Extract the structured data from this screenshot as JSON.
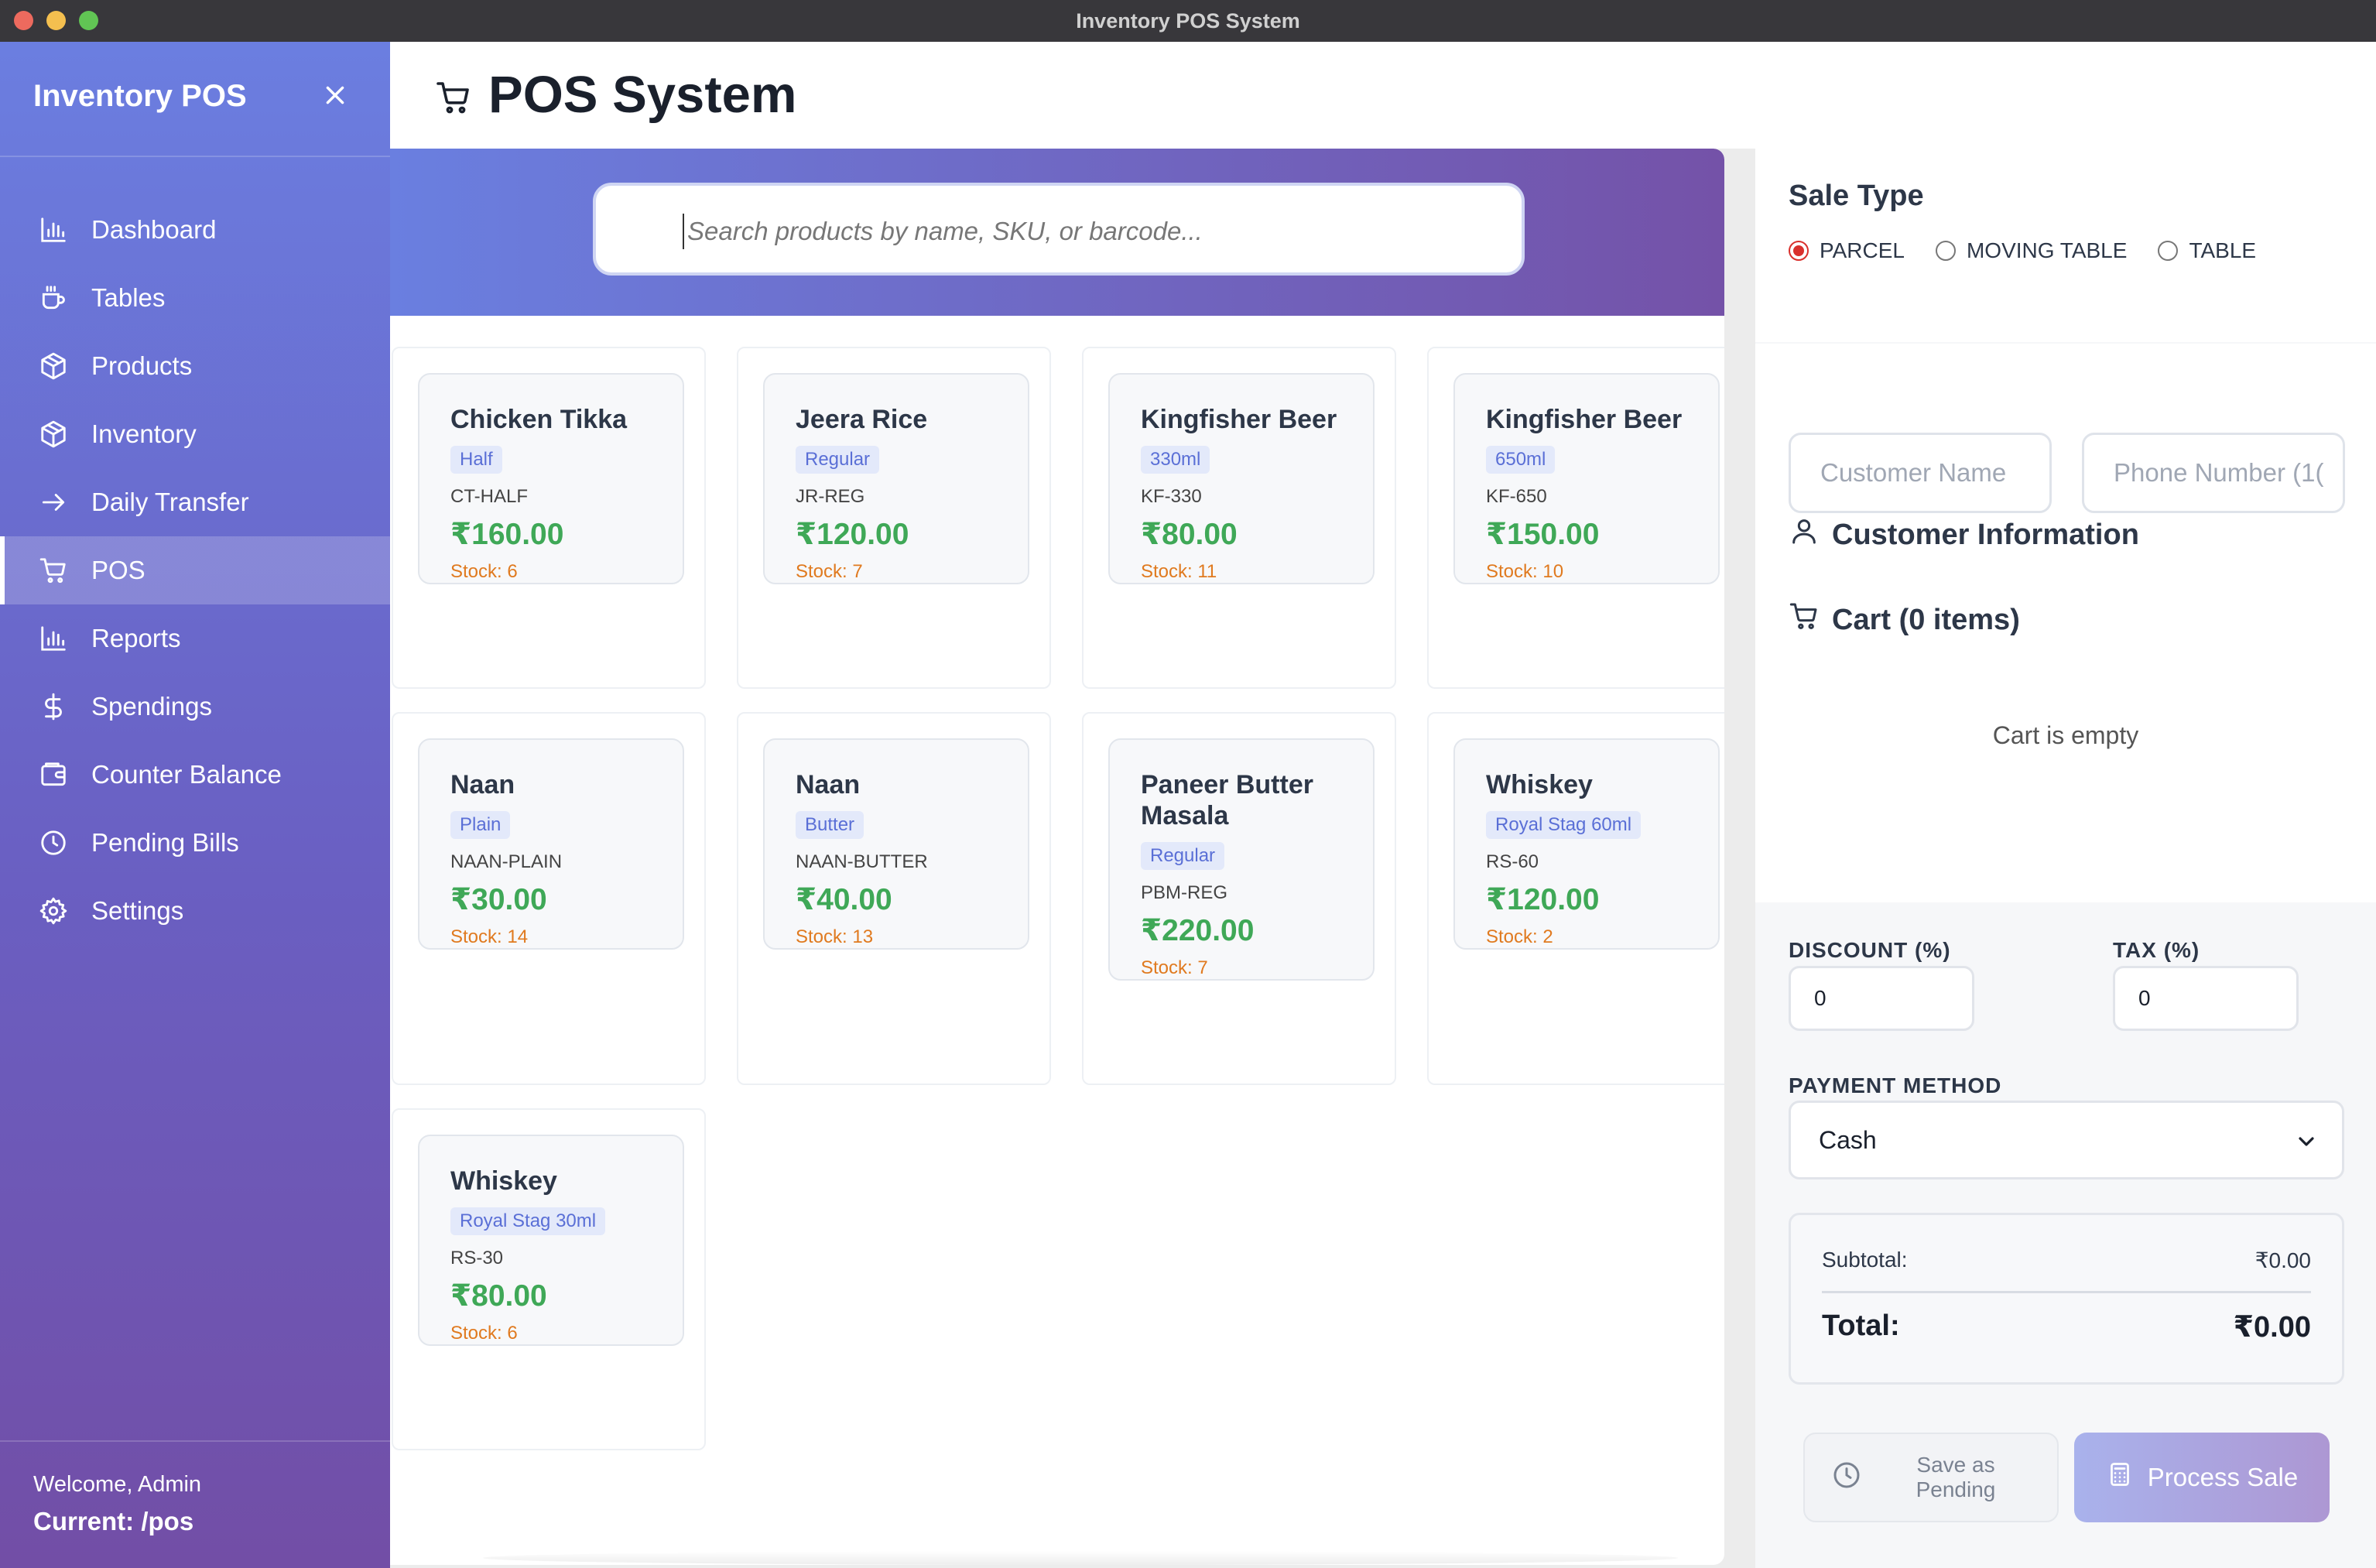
{
  "window": {
    "title": "Inventory POS System"
  },
  "sidebar": {
    "brand": "Inventory POS",
    "items": [
      {
        "label": "Dashboard",
        "icon": "chart-bar-icon",
        "active": false
      },
      {
        "label": "Tables",
        "icon": "coffee-icon",
        "active": false
      },
      {
        "label": "Products",
        "icon": "package-icon",
        "active": false
      },
      {
        "label": "Inventory",
        "icon": "package-icon",
        "active": false
      },
      {
        "label": "Daily Transfer",
        "icon": "arrow-right-icon",
        "active": false
      },
      {
        "label": "POS",
        "icon": "cart-icon",
        "active": true
      },
      {
        "label": "Reports",
        "icon": "chart-bar-icon",
        "active": false
      },
      {
        "label": "Spendings",
        "icon": "dollar-icon",
        "active": false
      },
      {
        "label": "Counter Balance",
        "icon": "wallet-icon",
        "active": false
      },
      {
        "label": "Pending Bills",
        "icon": "clock-icon",
        "active": false
      },
      {
        "label": "Settings",
        "icon": "gear-icon",
        "active": false
      }
    ],
    "welcome": "Welcome, Admin",
    "current": "Current: /pos"
  },
  "header": {
    "title": "POS System"
  },
  "search": {
    "placeholder": "Search products by name, SKU, or barcode..."
  },
  "products": [
    {
      "name": "Chicken Tikka",
      "variant": "Half",
      "sku": "CT-HALF",
      "price": "₹160.00",
      "stock": "Stock: 6"
    },
    {
      "name": "Jeera Rice",
      "variant": "Regular",
      "sku": "JR-REG",
      "price": "₹120.00",
      "stock": "Stock: 7"
    },
    {
      "name": "Kingfisher Beer",
      "variant": "330ml",
      "sku": "KF-330",
      "price": "₹80.00",
      "stock": "Stock: 11"
    },
    {
      "name": "Kingfisher Beer",
      "variant": "650ml",
      "sku": "KF-650",
      "price": "₹150.00",
      "stock": "Stock: 10"
    },
    {
      "name": "Naan",
      "variant": "Plain",
      "sku": "NAAN-PLAIN",
      "price": "₹30.00",
      "stock": "Stock: 14"
    },
    {
      "name": "Naan",
      "variant": "Butter",
      "sku": "NAAN-BUTTER",
      "price": "₹40.00",
      "stock": "Stock: 13"
    },
    {
      "name": "Paneer Butter Masala",
      "variant": "Regular",
      "sku": "PBM-REG",
      "price": "₹220.00",
      "stock": "Stock: 7"
    },
    {
      "name": "Whiskey",
      "variant": "Royal Stag 60ml",
      "sku": "RS-60",
      "price": "₹120.00",
      "stock": "Stock: 2"
    },
    {
      "name": "Whiskey",
      "variant": "Royal Stag 30ml",
      "sku": "RS-30",
      "price": "₹80.00",
      "stock": "Stock: 6"
    }
  ],
  "sale_type": {
    "title": "Sale Type",
    "options": [
      "PARCEL",
      "MOVING TABLE",
      "TABLE"
    ],
    "selected": "PARCEL"
  },
  "customer": {
    "title": "Customer Information",
    "name_placeholder": "Customer Name",
    "phone_placeholder": "Phone Number (1("
  },
  "cart": {
    "title": "Cart (0 items)",
    "empty_text": "Cart is empty"
  },
  "discount": {
    "label": "DISCOUNT (%)",
    "value": "0"
  },
  "tax": {
    "label": "TAX (%)",
    "value": "0"
  },
  "payment": {
    "label": "PAYMENT METHOD",
    "selected": "Cash"
  },
  "totals": {
    "subtotal_label": "Subtotal:",
    "subtotal_value": "₹0.00",
    "total_label": "Total:",
    "total_value": "₹0.00"
  },
  "actions": {
    "pending_line1": "Save as",
    "pending_line2": "Pending",
    "process_label": "Process Sale"
  },
  "colors": {
    "price": "#3fa857",
    "stock": "#e07a1f",
    "radio_selected": "#d9302c",
    "sidebar_top": "#6b7ee0",
    "sidebar_bottom": "#724ea6"
  }
}
